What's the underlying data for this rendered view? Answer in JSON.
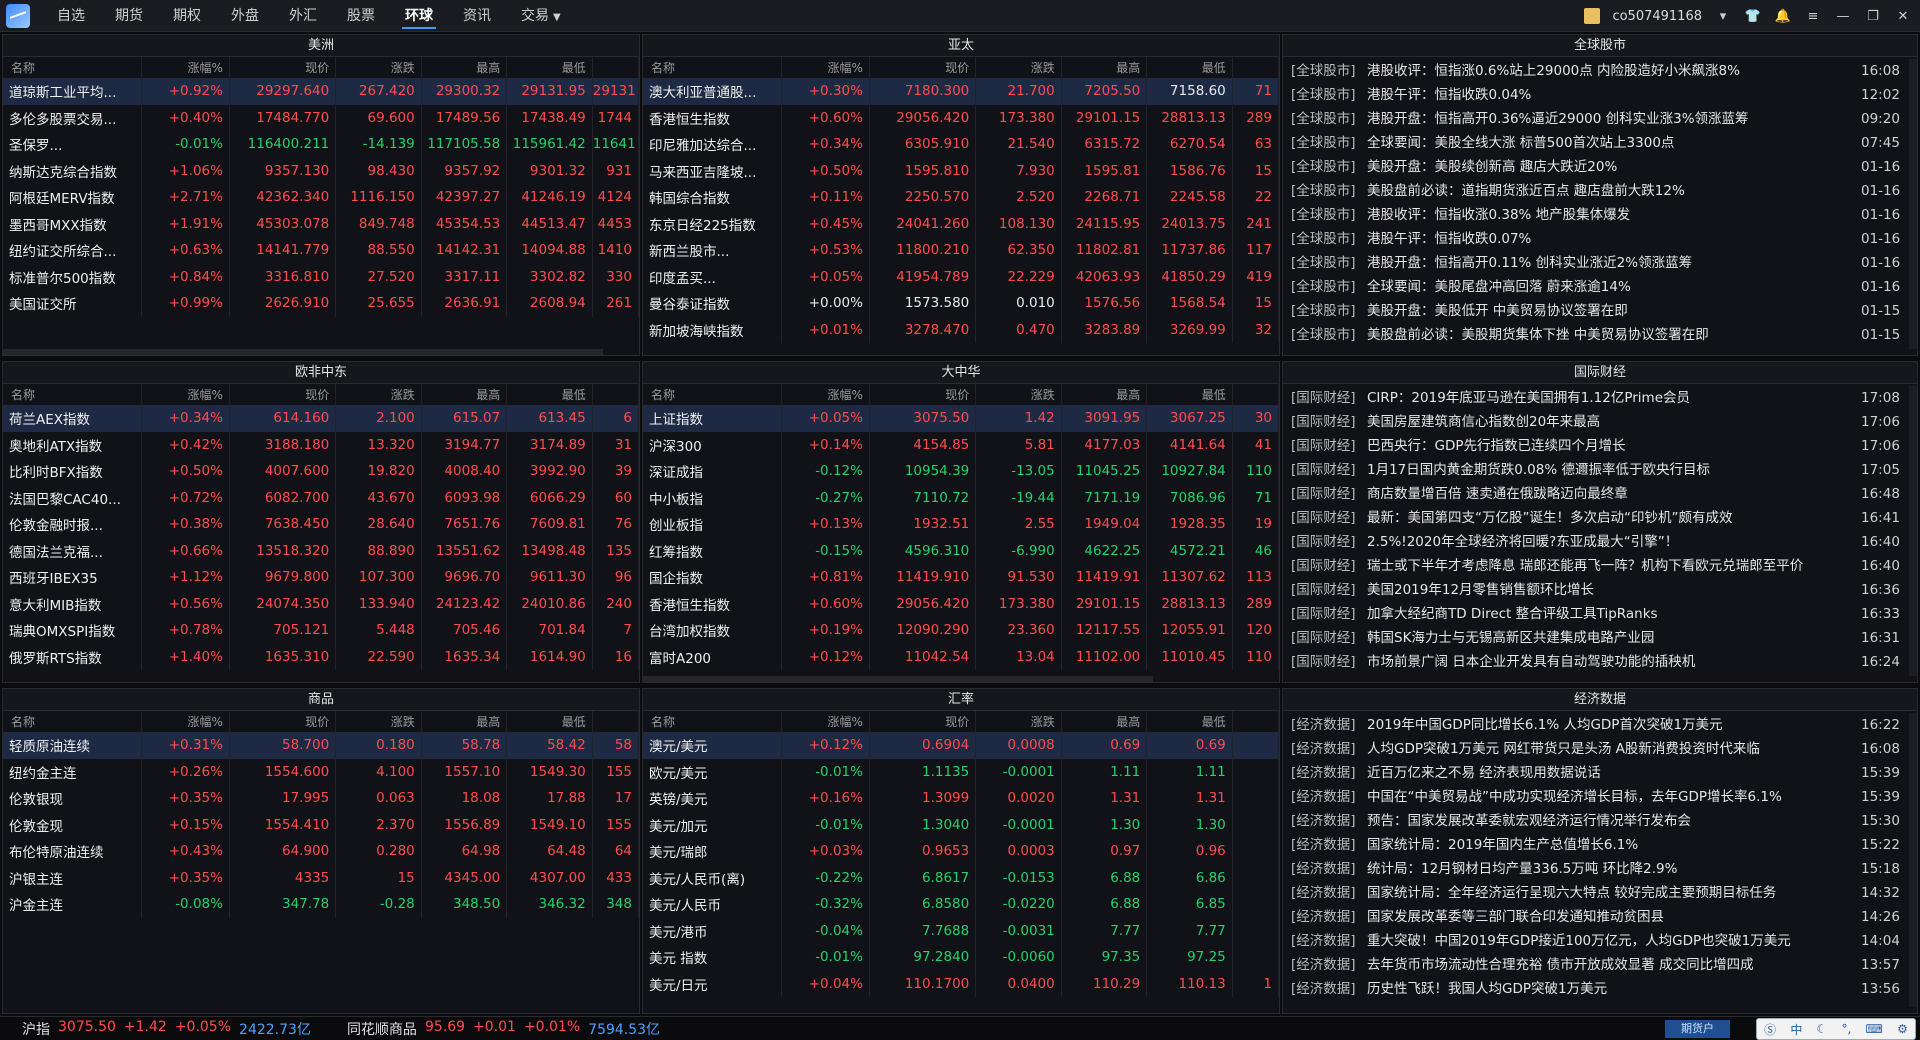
{
  "nav": {
    "items": [
      "自选",
      "期货",
      "期权",
      "外盘",
      "外汇",
      "股票",
      "环球",
      "资讯",
      "交易"
    ],
    "active": "环球"
  },
  "user": {
    "account": "co507491168"
  },
  "columns": [
    "名称",
    "涨幅%",
    "现价",
    "涨跌",
    "最高",
    "最低"
  ],
  "panels": {
    "americas": {
      "title": "美洲",
      "rows": [
        [
          "道琼斯工业平均...",
          "+0.92%",
          "29297.640",
          "267.420",
          "29300.32",
          "29131.95",
          "29131"
        ],
        [
          "多伦多股票交易...",
          "+0.40%",
          "17484.770",
          "69.600",
          "17489.56",
          "17438.49",
          "1744"
        ],
        [
          "圣保罗...",
          "-0.01%",
          "116400.211",
          "-14.139",
          "117105.58",
          "115961.42",
          "11641"
        ],
        [
          "纳斯达克综合指数",
          "+1.06%",
          "9357.130",
          "98.430",
          "9357.92",
          "9301.32",
          "931"
        ],
        [
          "阿根廷MERV指数",
          "+2.71%",
          "42362.340",
          "1116.150",
          "42397.27",
          "41246.19",
          "4124"
        ],
        [
          "墨西哥MXX指数",
          "+1.91%",
          "45303.078",
          "849.748",
          "45354.53",
          "44513.47",
          "4453"
        ],
        [
          "纽约证交所综合...",
          "+0.63%",
          "14141.779",
          "88.550",
          "14142.31",
          "14094.88",
          "1410"
        ],
        [
          "标准普尔500指数",
          "+0.84%",
          "3316.810",
          "27.520",
          "3317.11",
          "3302.82",
          "330"
        ],
        [
          "美国证交所",
          "+0.99%",
          "2626.910",
          "25.655",
          "2636.91",
          "2608.94",
          "261"
        ]
      ]
    },
    "asiapac": {
      "title": "亚太",
      "rows": [
        [
          "澳大利亚普通股...",
          "+0.30%",
          "7180.300",
          "21.700",
          "7205.50",
          "7158.60",
          "71"
        ],
        [
          "香港恒生指数",
          "+0.60%",
          "29056.420",
          "173.380",
          "29101.15",
          "28813.13",
          "289"
        ],
        [
          "印尼雅加达综合...",
          "+0.34%",
          "6305.910",
          "21.540",
          "6315.72",
          "6270.54",
          "63"
        ],
        [
          "马来西亚吉隆坡...",
          "+0.50%",
          "1595.810",
          "7.930",
          "1595.81",
          "1586.76",
          "15"
        ],
        [
          "韩国综合指数",
          "+0.11%",
          "2250.570",
          "2.520",
          "2268.71",
          "2245.58",
          "22"
        ],
        [
          "东京日经225指数",
          "+0.45%",
          "24041.260",
          "108.130",
          "24115.95",
          "24013.75",
          "241"
        ],
        [
          "新西兰股市...",
          "+0.53%",
          "11800.210",
          "62.350",
          "11802.81",
          "11737.86",
          "117"
        ],
        [
          "印度孟买...",
          "+0.05%",
          "41954.789",
          "22.229",
          "42063.93",
          "41850.29",
          "419"
        ],
        [
          "曼谷泰证指数",
          "+0.00%",
          "1573.580",
          "0.010",
          "1576.56",
          "1568.54",
          "15"
        ],
        [
          "新加坡海峡指数",
          "+0.01%",
          "3278.470",
          "0.470",
          "3283.89",
          "3269.99",
          "32"
        ]
      ]
    },
    "emea": {
      "title": "欧非中东",
      "rows": [
        [
          "荷兰AEX指数",
          "+0.34%",
          "614.160",
          "2.100",
          "615.07",
          "613.45",
          "6"
        ],
        [
          "奥地利ATX指数",
          "+0.42%",
          "3188.180",
          "13.320",
          "3194.77",
          "3174.89",
          "31"
        ],
        [
          "比利时BFX指数",
          "+0.50%",
          "4007.600",
          "19.820",
          "4008.40",
          "3992.90",
          "39"
        ],
        [
          "法国巴黎CAC40...",
          "+0.72%",
          "6082.700",
          "43.670",
          "6093.98",
          "6066.29",
          "60"
        ],
        [
          "伦敦金融时报...",
          "+0.38%",
          "7638.450",
          "28.640",
          "7651.76",
          "7609.81",
          "76"
        ],
        [
          "德国法兰克福...",
          "+0.66%",
          "13518.320",
          "88.890",
          "13551.62",
          "13498.48",
          "135"
        ],
        [
          "西班牙IBEX35",
          "+1.12%",
          "9679.800",
          "107.300",
          "9696.70",
          "9611.30",
          "96"
        ],
        [
          "意大利MIB指数",
          "+0.56%",
          "24074.350",
          "133.940",
          "24123.42",
          "24010.86",
          "240"
        ],
        [
          "瑞典OMXSPI指数",
          "+0.78%",
          "705.121",
          "5.448",
          "705.46",
          "701.84",
          "7"
        ],
        [
          "俄罗斯RTS指数",
          "+1.40%",
          "1635.310",
          "22.590",
          "1635.34",
          "1614.90",
          "16"
        ]
      ]
    },
    "greaterchina": {
      "title": "大中华",
      "rows": [
        [
          "上证指数",
          "+0.05%",
          "3075.50",
          "1.42",
          "3091.95",
          "3067.25",
          "30"
        ],
        [
          "沪深300",
          "+0.14%",
          "4154.85",
          "5.81",
          "4177.03",
          "4141.64",
          "41"
        ],
        [
          "深证成指",
          "-0.12%",
          "10954.39",
          "-13.05",
          "11045.25",
          "10927.84",
          "110"
        ],
        [
          "中小板指",
          "-0.27%",
          "7110.72",
          "-19.44",
          "7171.19",
          "7086.96",
          "71"
        ],
        [
          "创业板指",
          "+0.13%",
          "1932.51",
          "2.55",
          "1949.04",
          "1928.35",
          "19"
        ],
        [
          "红筹指数",
          "-0.15%",
          "4596.310",
          "-6.990",
          "4622.25",
          "4572.21",
          "46"
        ],
        [
          "国企指数",
          "+0.81%",
          "11419.910",
          "91.530",
          "11419.91",
          "11307.62",
          "113"
        ],
        [
          "香港恒生指数",
          "+0.60%",
          "29056.420",
          "173.380",
          "29101.15",
          "28813.13",
          "289"
        ],
        [
          "台湾加权指数",
          "+0.19%",
          "12090.290",
          "23.360",
          "12117.55",
          "12055.91",
          "120"
        ],
        [
          "富时A200",
          "+0.12%",
          "11042.54",
          "13.04",
          "11102.00",
          "11010.45",
          "110"
        ]
      ]
    },
    "commodities": {
      "title": "商品",
      "rows": [
        [
          "轻质原油连续",
          "+0.31%",
          "58.700",
          "0.180",
          "58.78",
          "58.42",
          "58"
        ],
        [
          "纽约金主连",
          "+0.26%",
          "1554.600",
          "4.100",
          "1557.10",
          "1549.30",
          "155"
        ],
        [
          "伦敦银现",
          "+0.35%",
          "17.995",
          "0.063",
          "18.08",
          "17.88",
          "17"
        ],
        [
          "伦敦金现",
          "+0.15%",
          "1554.410",
          "2.370",
          "1556.89",
          "1549.10",
          "155"
        ],
        [
          "布伦特原油连续",
          "+0.43%",
          "64.900",
          "0.280",
          "64.98",
          "64.48",
          "64"
        ],
        [
          "沪银主连",
          "+0.35%",
          "4335",
          "15",
          "4345.00",
          "4307.00",
          "433"
        ],
        [
          "沪金主连",
          "-0.08%",
          "347.78",
          "-0.28",
          "348.50",
          "346.32",
          "348"
        ]
      ]
    },
    "fx": {
      "title": "汇率",
      "rows": [
        [
          "澳元/美元",
          "+0.12%",
          "0.6904",
          "0.0008",
          "0.69",
          "0.69",
          ""
        ],
        [
          "欧元/美元",
          "-0.01%",
          "1.1135",
          "-0.0001",
          "1.11",
          "1.11",
          ""
        ],
        [
          "英镑/美元",
          "+0.16%",
          "1.3099",
          "0.0020",
          "1.31",
          "1.31",
          ""
        ],
        [
          "美元/加元",
          "-0.01%",
          "1.3040",
          "-0.0001",
          "1.30",
          "1.30",
          ""
        ],
        [
          "美元/瑞郎",
          "+0.03%",
          "0.9653",
          "0.0003",
          "0.97",
          "0.96",
          ""
        ],
        [
          "美元/人民币(离)",
          "-0.22%",
          "6.8617",
          "-0.0153",
          "6.88",
          "6.86",
          ""
        ],
        [
          "美元/人民币",
          "-0.32%",
          "6.8580",
          "-0.0220",
          "6.88",
          "6.85",
          ""
        ],
        [
          "美元/港币",
          "-0.04%",
          "7.7688",
          "-0.0031",
          "7.77",
          "7.77",
          ""
        ],
        [
          "美元 指数",
          "-0.01%",
          "97.2840",
          "-0.0060",
          "97.35",
          "97.25",
          ""
        ],
        [
          "美元/日元",
          "+0.04%",
          "110.1700",
          "0.0400",
          "110.29",
          "110.13",
          "1"
        ]
      ]
    }
  },
  "news": {
    "global": {
      "title": "全球股市",
      "items": [
        [
          "[全球股市]",
          "港股收评：恒指涨0.6%站上29000点 内险股造好小米飙涨8%",
          "16:08"
        ],
        [
          "[全球股市]",
          "港股午评：恒指收跌0.04%",
          "12:02"
        ],
        [
          "[全球股市]",
          "港股开盘：恒指高开0.36%逼近29000 创科实业涨3%领涨蓝筹",
          "09:20"
        ],
        [
          "[全球股市]",
          "全球要闻：美股全线大涨 标普500首次站上3300点",
          "07:45"
        ],
        [
          "[全球股市]",
          "美股开盘：美股续创新高 趣店大跌近20%",
          "01-16"
        ],
        [
          "[全球股市]",
          "美股盘前必读：道指期货涨近百点 趣店盘前大跌12%",
          "01-16"
        ],
        [
          "[全球股市]",
          "港股收评：恒指收涨0.38% 地产股集体爆发",
          "01-16"
        ],
        [
          "[全球股市]",
          "港股午评：恒指收跌0.07%",
          "01-16"
        ],
        [
          "[全球股市]",
          "港股开盘：恒指高开0.11% 创科实业涨近2%领涨蓝筹",
          "01-16"
        ],
        [
          "[全球股市]",
          "全球要闻：美股尾盘冲高回落 蔚来涨逾14%",
          "01-16"
        ],
        [
          "[全球股市]",
          "美股开盘：美股低开 中美贸易协议签署在即",
          "01-15"
        ],
        [
          "[全球股市]",
          "美股盘前必读：美股期货集体下挫 中美贸易协议签署在即",
          "01-15"
        ]
      ]
    },
    "intl": {
      "title": "国际财经",
      "items": [
        [
          "[国际财经]",
          "CIRP：2019年底亚马逊在美国拥有1.12亿Prime会员",
          "17:08"
        ],
        [
          "[国际财经]",
          "美国房屋建筑商信心指数创20年来最高",
          "17:06"
        ],
        [
          "[国际财经]",
          "巴西央行：GDP先行指数已连续四个月增长",
          "17:06"
        ],
        [
          "[国际财经]",
          "1月17日国内黄金期货跌0.08% 德邇振率低于欧央行目标",
          "17:05"
        ],
        [
          "[国际财经]",
          "商店数量增百倍 速卖通在俄跋略迈向最终章",
          "16:48"
        ],
        [
          "[国际财经]",
          "最新：美国第四支“万亿股”诞生！多次启动“印钞机”颇有成效",
          "16:41"
        ],
        [
          "[国际财经]",
          "2.5%!2020年全球经济将回暖?东亚成最大“引擎”！",
          "16:40"
        ],
        [
          "[国际财经]",
          "瑞士或下半年才考虑降息 瑞郎还能再飞一阵？机构下看欧元兑瑞郎至平价",
          "16:40"
        ],
        [
          "[国际财经]",
          "美国2019年12月零售销售额环比增长",
          "16:36"
        ],
        [
          "[国际财经]",
          "加拿大经纪商TD Direct 整合评级工具TipRanks",
          "16:33"
        ],
        [
          "[国际财经]",
          "韩国SK海力士与无锡高新区共建集成电路产业园",
          "16:31"
        ],
        [
          "[国际财经]",
          "市场前景广阔 日本企业开发具有自动驾驶功能的插秧机",
          "16:24"
        ]
      ]
    },
    "econ": {
      "title": "经济数据",
      "items": [
        [
          "[经济数据]",
          "2019年中国GDP同比增长6.1% 人均GDP首次突破1万美元",
          "16:22"
        ],
        [
          "[经济数据]",
          "人均GDP突破1万美元 网红带货只是头汤 A股新消费投资时代来临",
          "16:08"
        ],
        [
          "[经济数据]",
          "近百万亿来之不易 经济表现用数据说话",
          "15:39"
        ],
        [
          "[经济数据]",
          "中国在“中美贸易战”中成功实现经济增长目标，去年GDP增长率6.1%",
          "15:39"
        ],
        [
          "[经济数据]",
          "预告：国家发展改革委就宏观经济运行情况举行发布会",
          "15:30"
        ],
        [
          "[经济数据]",
          "国家统计局：2019年国内生产总值增长6.1%",
          "15:22"
        ],
        [
          "[经济数据]",
          "统计局：12月钢材日均产量336.5万吨 环比降2.9%",
          "15:18"
        ],
        [
          "[经济数据]",
          "国家统计局：全年经济运行呈现六大特点 较好完成主要预期目标任务",
          "14:32"
        ],
        [
          "[经济数据]",
          "国家发展改革委等三部门联合印发通知推动贫困县",
          "14:26"
        ],
        [
          "[经济数据]",
          "重大突破！中国2019年GDP接近100万亿元，人均GDP也突破1万美元",
          "14:04"
        ],
        [
          "[经济数据]",
          "去年货币市场流动性合理充裕 债市开放成效显著 成交同比增四成",
          "13:57"
        ],
        [
          "[经济数据]",
          "历史性飞跃！我国人均GDP突破1万美元",
          "13:56"
        ]
      ]
    }
  },
  "status": {
    "sh_label": "沪指",
    "sh_price": "3075.50",
    "sh_chg": "+1.42",
    "sh_pct": "+0.05%",
    "sh_amt": "2422.73亿",
    "ths_label": "同花顺商品",
    "ths_price": "95.69",
    "ths_chg": "+0.01",
    "ths_pct": "+0.01%",
    "ths_amt": "7594.53亿",
    "btn": "期货户"
  }
}
